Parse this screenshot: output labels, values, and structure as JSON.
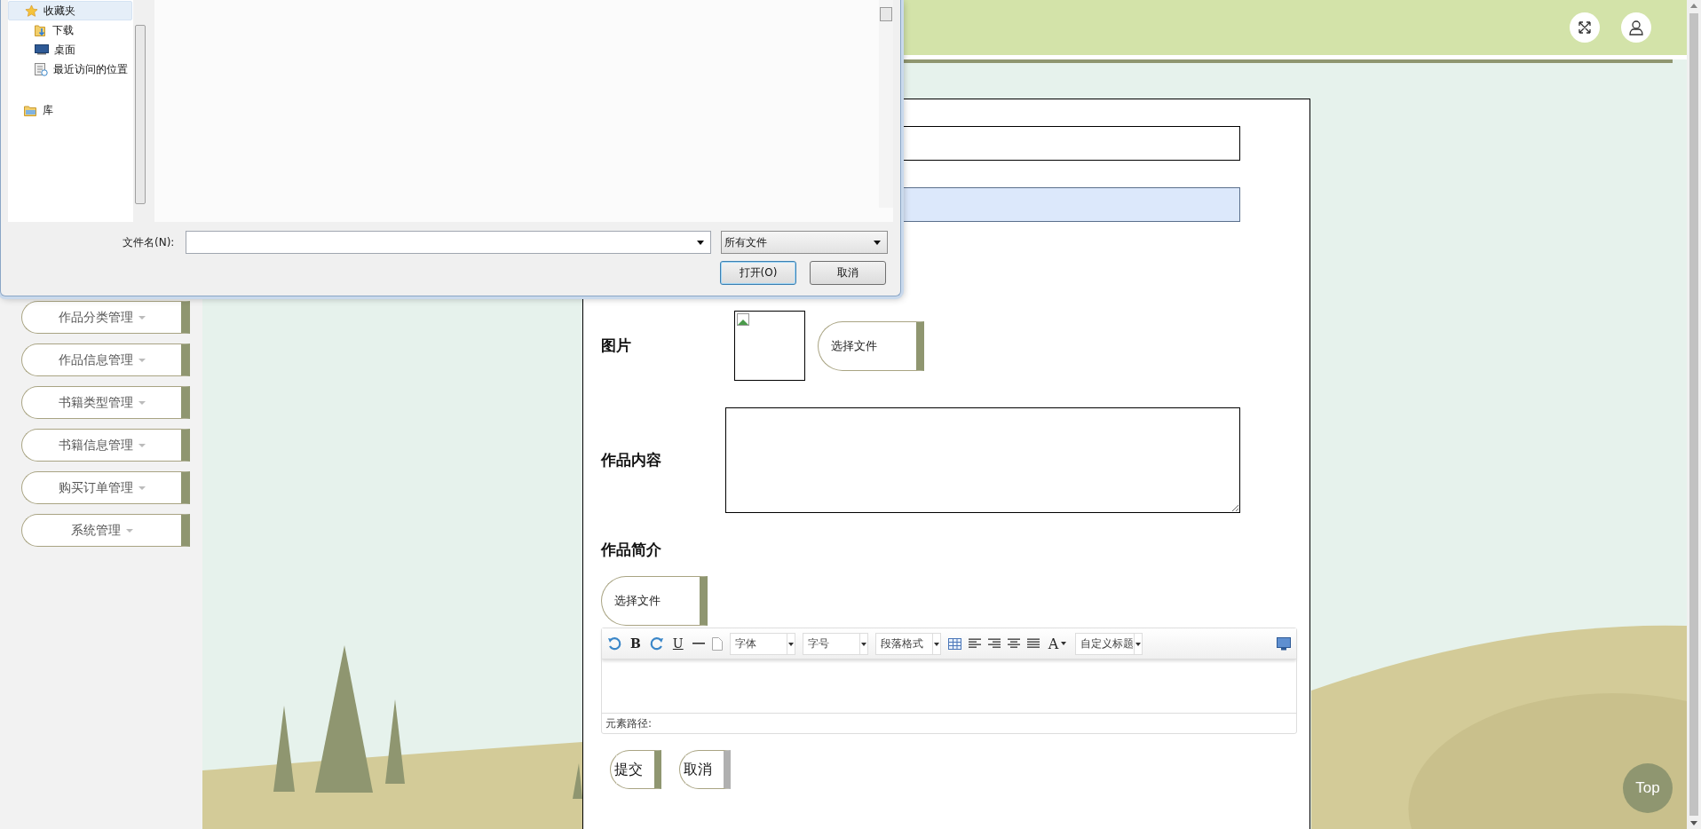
{
  "dialog": {
    "nav": [
      {
        "label": "收藏夹",
        "kind": "star",
        "selected": true,
        "children": [
          {
            "label": "下载",
            "kind": "download",
            "selected": false
          },
          {
            "label": "桌面",
            "kind": "desktop",
            "selected": false
          },
          {
            "label": "最近访问的位置",
            "kind": "recent",
            "selected": false
          }
        ]
      },
      {
        "label": "库",
        "kind": "library",
        "selected": false
      }
    ],
    "file_name_label": "文件名(N):",
    "file_type": "所有文件",
    "buttons": [
      {
        "label": "打开(O)",
        "kind": "primary"
      },
      {
        "label": "取消",
        "kind": "normal"
      }
    ]
  },
  "sidebar": {
    "items": [
      {
        "label": "作品分类管理"
      },
      {
        "label": "作品信息管理"
      },
      {
        "label": "书籍类型管理"
      },
      {
        "label": "书籍信息管理"
      },
      {
        "label": "购买订单管理"
      },
      {
        "label": "系统管理"
      }
    ]
  },
  "form": {
    "fields": [
      {
        "kind": "input",
        "focused": false
      },
      {
        "kind": "input",
        "focused": true
      },
      {
        "kind": "image",
        "label": "图片",
        "button": "选择文件"
      },
      {
        "kind": "textarea",
        "label": "作品内容"
      },
      {
        "kind": "editor",
        "label": "作品简介",
        "button": "选择文件",
        "path_label": "元素路径:",
        "toolbar": [
          {
            "kind": "undo"
          },
          {
            "kind": "glyph",
            "text": "B"
          },
          {
            "kind": "redo"
          },
          {
            "kind": "underline",
            "text": "U"
          },
          {
            "kind": "rule"
          },
          {
            "kind": "page"
          },
          {
            "kind": "select",
            "text": "字体"
          },
          {
            "kind": "select",
            "text": "字号"
          },
          {
            "kind": "select",
            "text": "段落格式"
          },
          {
            "kind": "table"
          },
          {
            "kind": "align-left"
          },
          {
            "kind": "align-right"
          },
          {
            "kind": "align-center"
          },
          {
            "kind": "justify"
          },
          {
            "kind": "color",
            "text": "A"
          },
          {
            "kind": "select",
            "text": "自定义标题"
          },
          {
            "kind": "preview"
          }
        ]
      }
    ],
    "actions": [
      {
        "label": "提交",
        "kind": "primary"
      },
      {
        "label": "取消",
        "kind": "secondary"
      }
    ]
  },
  "back_to_top": "Top"
}
